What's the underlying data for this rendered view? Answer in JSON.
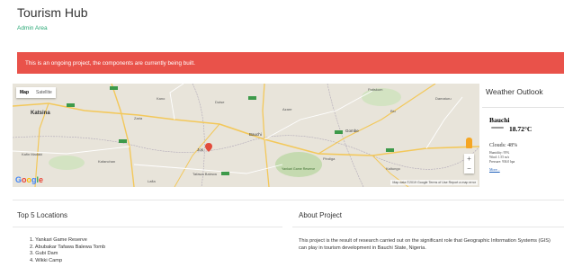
{
  "header": {
    "title": "Tourism Hub",
    "admin_link": "Admin Area"
  },
  "alert": {
    "text": "This is an ongoing project, the components are currently being built."
  },
  "map": {
    "type_buttons": [
      "Map",
      "Satellite"
    ],
    "active_type": "Map",
    "places": [
      "Kaduna",
      "Zaria",
      "Katsina",
      "Bauchi",
      "Gombe",
      "Jos",
      "Kafanchan",
      "Yankari Game Reserve",
      "Biu",
      "Damaturu",
      "Potiskum",
      "Azare",
      "Kano",
      "Dutse",
      "Kafin Madaki",
      "Tafawa Balewa",
      "Pindiga",
      "Kaltungo",
      "Lafia"
    ],
    "footer": "Map data ©2019 Google   Terms of Use   Report a map error",
    "zoom_in": "+",
    "zoom_out": "−"
  },
  "weather": {
    "title": "Weather Outlook",
    "city": "Bauchi",
    "temp": "18.72°C",
    "clouds": "Clouds: 48%",
    "humidity": "Humidity: 95%",
    "wind": "Wind: 1.55 m/s",
    "pressure": "Pressure: 936.0 hpa",
    "more": "More...",
    "icon": "cloud-icon"
  },
  "top_locations": {
    "title": "Top 5 Locations",
    "items": [
      "1. Yankari Game Reserve",
      "2. Abubakar Tafawa Balewa Tomb",
      "3. Gubi Dam",
      "4. Wikki Camp"
    ]
  },
  "about": {
    "title": "About Project",
    "text": "This project is the result of research carried out on the significant role that Geographic Information Systems (GIS) can play in tourism development in Bauchi State, Nigeria."
  },
  "colors": {
    "alert_bg": "#e9524a",
    "link": "#2aa876",
    "map_bg": "#e8e4da",
    "road": "#f3c85a",
    "park": "#c5dab0"
  }
}
